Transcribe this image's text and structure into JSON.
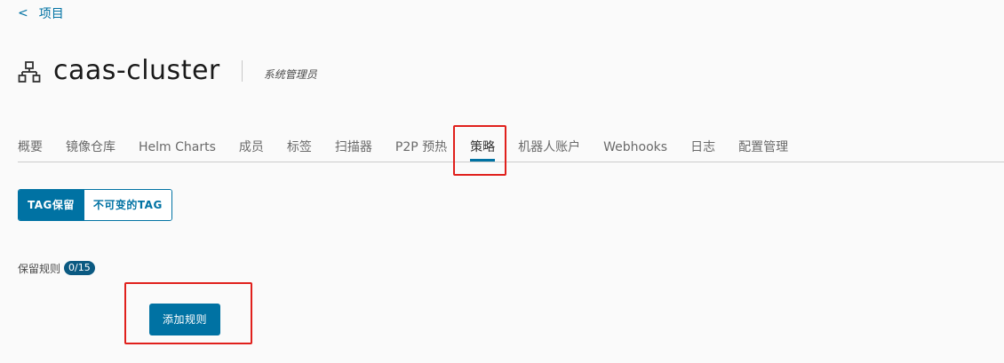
{
  "breadcrumb": {
    "back_icon": "chevron-left-icon",
    "label": "项目"
  },
  "header": {
    "icon": "organization-icon",
    "project_name": "caas-cluster",
    "role": "系统管理员"
  },
  "tabs": [
    {
      "label": "概要"
    },
    {
      "label": "镜像仓库"
    },
    {
      "label": "Helm Charts"
    },
    {
      "label": "成员"
    },
    {
      "label": "标签"
    },
    {
      "label": "扫描器"
    },
    {
      "label": "P2P 预热"
    },
    {
      "label": "策略",
      "active": true
    },
    {
      "label": "机器人账户"
    },
    {
      "label": "Webhooks"
    },
    {
      "label": "日志"
    },
    {
      "label": "配置管理"
    }
  ],
  "policy_tabs": {
    "tag_retention": "TAG保留",
    "immutable_tag": "不可变的TAG",
    "selected": "TAG保留"
  },
  "retention": {
    "rules_label": "保留规则",
    "rules_count": "0/15",
    "add_rule_label": "添加规则"
  },
  "colors": {
    "accent": "#0072a3",
    "highlight": "#e0201c",
    "badge": "#0b5a82"
  }
}
